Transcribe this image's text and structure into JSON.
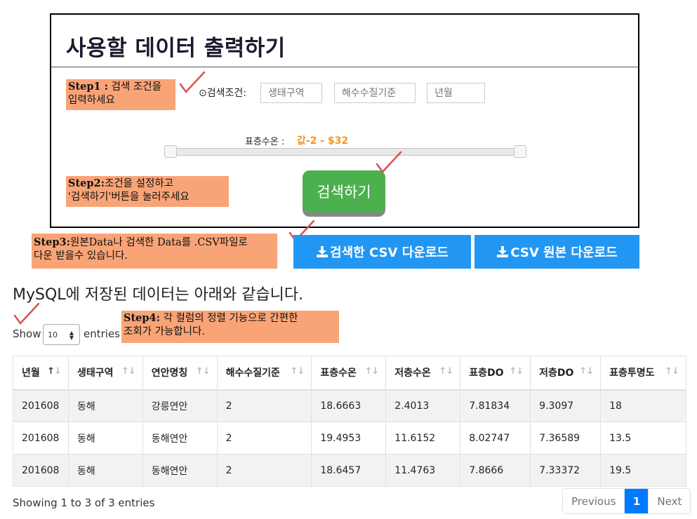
{
  "panel": {
    "title": "사용할 데이터 출력하기",
    "condition_label": "⊙검색조건:",
    "inputs": [
      {
        "placeholder": "생태구역"
      },
      {
        "placeholder": "해수수질기준"
      },
      {
        "placeholder": "년월"
      }
    ],
    "temp_label": "표층수온 :",
    "temp_value": "값-2 - $32",
    "search_button": "검색하기"
  },
  "notes": {
    "step1_bold": "Step1 :",
    "step1_text": " 검색 조건을",
    "step1_line2": "입력하세요",
    "step2_bold": "Step2:",
    "step2_text": "조건을 설정하고",
    "step2_line2": "'검색하기'버튼을 눌러주세요",
    "step3_bold": "Step3:",
    "step3_text": "원본Data나 검색한 Data를 .CSV파일로",
    "step3_line2": "다운 받을수 있습니다.",
    "step4_bold": "Step4:",
    "step4_text": " 각 컬럼의 정렬 기능으로 간편한",
    "step4_line2": "조회가 가능합니다."
  },
  "downloads": {
    "filtered": "검색한 CSV 다운로드",
    "original": "CSV 원본 다운로드"
  },
  "section_title": "MySQL에 저장된 데이터는 아래와 같습니다.",
  "length_menu": {
    "show": "Show",
    "value": "10",
    "entries": "entries"
  },
  "table": {
    "columns": [
      "년월",
      "생태구역",
      "연안명칭",
      "해수수질기준",
      "표층수온",
      "저층수온",
      "표층DO",
      "저층DO",
      "표층투명도"
    ],
    "rows": [
      [
        "201608",
        "동해",
        "강릉연안",
        "2",
        "18.6663",
        "2.4013",
        "7.81834",
        "9.3097",
        "18"
      ],
      [
        "201608",
        "동해",
        "동해연안",
        "2",
        "19.4953",
        "11.6152",
        "8.02747",
        "7.36589",
        "13.5"
      ],
      [
        "201608",
        "동해",
        "동해연안",
        "2",
        "18.6457",
        "11.4763",
        "7.8666",
        "7.33372",
        "19.5"
      ]
    ]
  },
  "footer": {
    "info": "Showing 1 to 3 of 3 entries",
    "previous": "Previous",
    "page": "1",
    "next": "Next"
  },
  "colors": {
    "search_green": "#4cb04f",
    "download_blue": "#2196f3",
    "note_orange": "#f9a477",
    "page_active": "#007bff"
  }
}
